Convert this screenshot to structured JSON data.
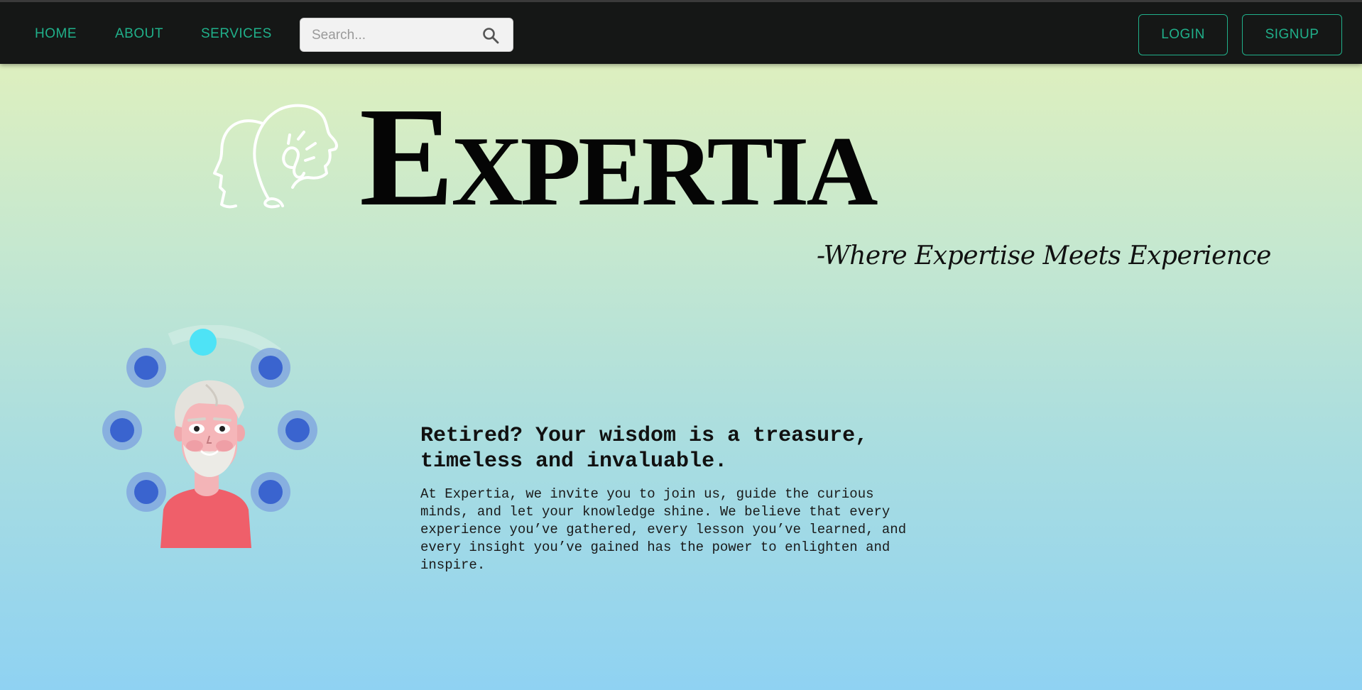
{
  "nav": {
    "links": [
      {
        "label": "HOME"
      },
      {
        "label": "ABOUT"
      },
      {
        "label": "SERVICES"
      }
    ],
    "search": {
      "placeholder": "Search...",
      "icon": "search-icon"
    },
    "login_label": "LOGIN",
    "signup_label": "SIGNUP"
  },
  "hero": {
    "brand": "Expertia",
    "tagline": "-Where Expertise Meets Experience",
    "logo_icon": "head-lightbulb-icon"
  },
  "intro": {
    "illustration": "elderly-man-avatar",
    "headline": "Retired? Your wisdom is a treasure, timeless and invaluable.",
    "description": "At Expertia, we invite you to join us, guide the curious minds, and let your knowledge shine. We believe that every experience you’ve gathered, every lesson you’ve learned, and every insight you’ve gained has the power to enlighten and inspire."
  },
  "colors": {
    "nav_bg": "#151716",
    "accent": "#20b08a",
    "bg_top": "#e6f2b9",
    "bg_bottom": "#8fd2f2"
  }
}
